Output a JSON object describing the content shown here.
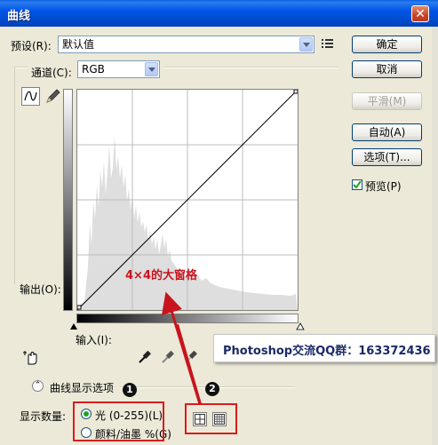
{
  "window": {
    "title": "曲线",
    "close": "✕"
  },
  "preset": {
    "label": "预设(R):",
    "value": "默认值"
  },
  "channel": {
    "label": "通道(C):",
    "value": "RGB"
  },
  "buttons": {
    "ok": "确定",
    "cancel": "取消",
    "smooth": "平滑(M)",
    "auto": "自动(A)",
    "options": "选项(T)..."
  },
  "preview": {
    "label": "预览(P)",
    "checked": true
  },
  "graph": {
    "output_label": "输出(O):",
    "input_label": "输入(I):",
    "annotation": "4×4的大窗格"
  },
  "curve_display": {
    "label": "曲线显示选项"
  },
  "show_amount": {
    "label": "显示数量:",
    "light": "光 (0-255)(L)",
    "pigment": "颜料/油墨 %(G)",
    "selected": "light"
  },
  "callout": {
    "text": "Photoshop交流QQ群：163372436"
  },
  "badges": {
    "one": "1",
    "two": "2"
  },
  "colors": {
    "title_bar": "#0054e3",
    "annotation_red": "#c8141e",
    "callout_text": "#1a2a66"
  }
}
